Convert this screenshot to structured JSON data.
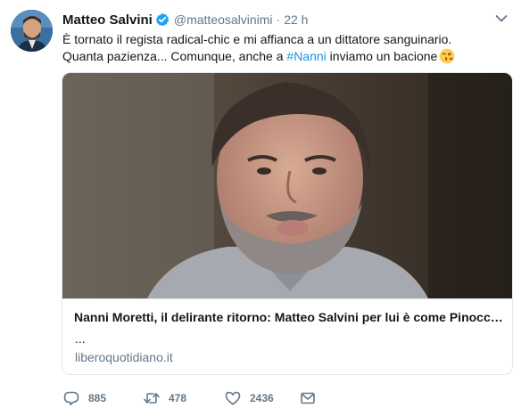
{
  "tweet": {
    "author": {
      "name": "Matteo Salvini",
      "handle": "@matteosalvinimi",
      "verified": true
    },
    "separator": "·",
    "time": "22 h",
    "text_line1": "È tornato il regista radical-chic e mi affianca a un dittatore sanguinario.",
    "text_line2_prefix": "Quanta pazienza... Comunque, anche a ",
    "hashtag": "#Nanni",
    "text_line2_suffix": " inviamo un bacione",
    "emoji": "face-blowing-a-kiss",
    "card": {
      "title": "Nanni Moretti, il delirante ritorno: Matteo Salvini per lui è come Pinocchio",
      "description": "...",
      "domain": "liberoquotidiano.it"
    },
    "actions": {
      "replies": "885",
      "retweets": "478",
      "likes": "2436"
    }
  },
  "colors": {
    "accent": "#1da1f2",
    "hashtag": "#1b95e0",
    "muted": "#657786",
    "text": "#14171a",
    "border": "#e1e8ed"
  }
}
